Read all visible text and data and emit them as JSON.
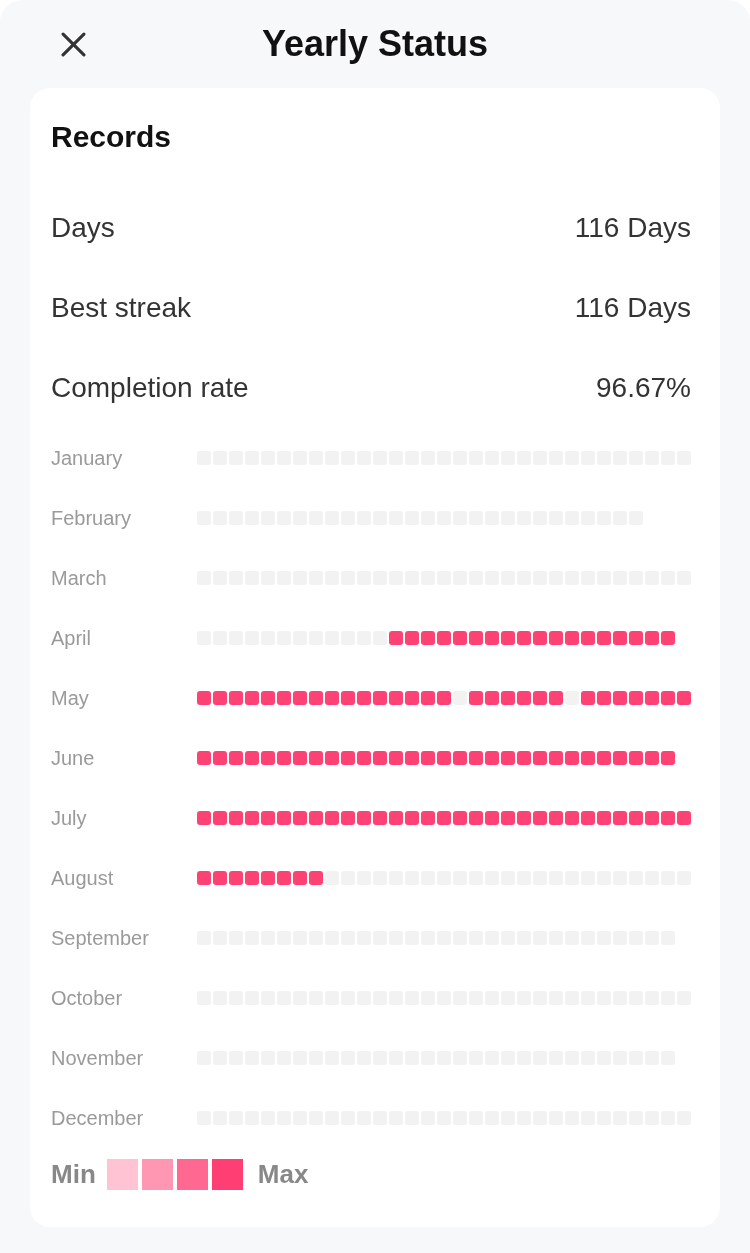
{
  "header": {
    "title": "Yearly Status"
  },
  "records": {
    "title": "Records",
    "stats": [
      {
        "label": "Days",
        "value": "116 Days"
      },
      {
        "label": "Best streak",
        "value": "116 Days"
      },
      {
        "label": "Completion rate",
        "value": "96.67%"
      }
    ]
  },
  "months": [
    {
      "name": "January",
      "days": [
        false,
        false,
        false,
        false,
        false,
        false,
        false,
        false,
        false,
        false,
        false,
        false,
        false,
        false,
        false,
        false,
        false,
        false,
        false,
        false,
        false,
        false,
        false,
        false,
        false,
        false,
        false,
        false,
        false,
        false,
        false
      ]
    },
    {
      "name": "February",
      "days": [
        false,
        false,
        false,
        false,
        false,
        false,
        false,
        false,
        false,
        false,
        false,
        false,
        false,
        false,
        false,
        false,
        false,
        false,
        false,
        false,
        false,
        false,
        false,
        false,
        false,
        false,
        false,
        false
      ]
    },
    {
      "name": "March",
      "days": [
        false,
        false,
        false,
        false,
        false,
        false,
        false,
        false,
        false,
        false,
        false,
        false,
        false,
        false,
        false,
        false,
        false,
        false,
        false,
        false,
        false,
        false,
        false,
        false,
        false,
        false,
        false,
        false,
        false,
        false,
        false
      ]
    },
    {
      "name": "April",
      "days": [
        false,
        false,
        false,
        false,
        false,
        false,
        false,
        false,
        false,
        false,
        false,
        false,
        true,
        true,
        true,
        true,
        true,
        true,
        true,
        true,
        true,
        true,
        true,
        true,
        true,
        true,
        true,
        true,
        true,
        true
      ]
    },
    {
      "name": "May",
      "days": [
        true,
        true,
        true,
        true,
        true,
        true,
        true,
        true,
        true,
        true,
        true,
        true,
        true,
        true,
        true,
        true,
        false,
        true,
        true,
        true,
        true,
        true,
        true,
        false,
        true,
        true,
        true,
        true,
        true,
        true,
        true
      ]
    },
    {
      "name": "June",
      "days": [
        true,
        true,
        true,
        true,
        true,
        true,
        true,
        true,
        true,
        true,
        true,
        true,
        true,
        true,
        true,
        true,
        true,
        true,
        true,
        true,
        true,
        true,
        true,
        true,
        true,
        true,
        true,
        true,
        true,
        true
      ]
    },
    {
      "name": "July",
      "days": [
        true,
        true,
        true,
        true,
        true,
        true,
        true,
        true,
        true,
        true,
        true,
        true,
        true,
        true,
        true,
        true,
        true,
        true,
        true,
        true,
        true,
        true,
        true,
        true,
        true,
        true,
        true,
        true,
        true,
        true,
        true
      ]
    },
    {
      "name": "August",
      "days": [
        true,
        true,
        true,
        true,
        true,
        true,
        true,
        true,
        false,
        false,
        false,
        false,
        false,
        false,
        false,
        false,
        false,
        false,
        false,
        false,
        false,
        false,
        false,
        false,
        false,
        false,
        false,
        false,
        false,
        false,
        false
      ]
    },
    {
      "name": "September",
      "days": [
        false,
        false,
        false,
        false,
        false,
        false,
        false,
        false,
        false,
        false,
        false,
        false,
        false,
        false,
        false,
        false,
        false,
        false,
        false,
        false,
        false,
        false,
        false,
        false,
        false,
        false,
        false,
        false,
        false,
        false
      ]
    },
    {
      "name": "October",
      "days": [
        false,
        false,
        false,
        false,
        false,
        false,
        false,
        false,
        false,
        false,
        false,
        false,
        false,
        false,
        false,
        false,
        false,
        false,
        false,
        false,
        false,
        false,
        false,
        false,
        false,
        false,
        false,
        false,
        false,
        false,
        false
      ]
    },
    {
      "name": "November",
      "days": [
        false,
        false,
        false,
        false,
        false,
        false,
        false,
        false,
        false,
        false,
        false,
        false,
        false,
        false,
        false,
        false,
        false,
        false,
        false,
        false,
        false,
        false,
        false,
        false,
        false,
        false,
        false,
        false,
        false,
        false
      ]
    },
    {
      "name": "December",
      "days": [
        false,
        false,
        false,
        false,
        false,
        false,
        false,
        false,
        false,
        false,
        false,
        false,
        false,
        false,
        false,
        false,
        false,
        false,
        false,
        false,
        false,
        false,
        false,
        false,
        false,
        false,
        false,
        false,
        false,
        false,
        false
      ]
    }
  ],
  "legend": {
    "min_label": "Min",
    "swatches": [
      {
        "color": "#ffc3d4"
      },
      {
        "color": "#ff97b3"
      },
      {
        "color": "#ff6891"
      },
      {
        "color": "#ff3f74"
      }
    ],
    "max_label": "Max"
  }
}
